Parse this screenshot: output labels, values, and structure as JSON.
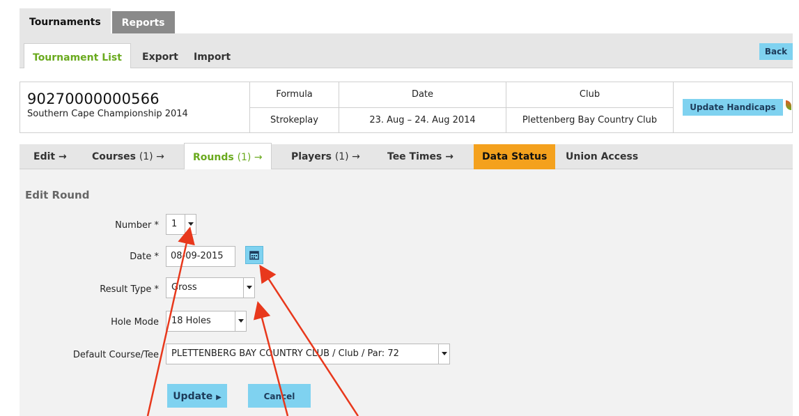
{
  "top_tabs": {
    "tournaments": "Tournaments",
    "reports": "Reports"
  },
  "sub_tabs": {
    "tournament_list": "Tournament List",
    "export": "Export",
    "import": "Import",
    "back": "Back"
  },
  "tournament": {
    "id": "90270000000566",
    "name": "Southern Cape Championship 2014",
    "formula_label": "Formula",
    "formula": "Strokeplay",
    "date_label": "Date",
    "date": "23. Aug – 24. Aug 2014",
    "club_label": "Club",
    "club": "Plettenberg Bay Country Club",
    "update_handicaps": "Update Handicaps"
  },
  "flow_tabs": {
    "edit": "Edit →",
    "courses": "Courses",
    "courses_count": "(1) →",
    "rounds": "Rounds",
    "rounds_count": "(1) →",
    "players": "Players",
    "players_count": "(1) →",
    "tee_times": "Tee Times →",
    "data_status": "Data Status",
    "union_access": "Union Access"
  },
  "form": {
    "title": "Edit Round",
    "number_label": "Number *",
    "number_value": "1",
    "date_label": "Date *",
    "date_value": "08-09-2015",
    "result_type_label": "Result Type *",
    "result_type_value": "Gross",
    "hole_mode_label": "Hole Mode",
    "hole_mode_value": "18 Holes",
    "course_tee_label": "Default Course/Tee",
    "course_tee_value": "PLETTENBERG BAY COUNTRY CLUB / Club / Par: 72",
    "update_button": "Update",
    "cancel_button": "Cancel"
  },
  "colors": {
    "accent_green": "#6aaa1e",
    "button_blue": "#7fd2f0",
    "orange_tab": "#f4a11d",
    "annotation_red": "#e8381c"
  }
}
